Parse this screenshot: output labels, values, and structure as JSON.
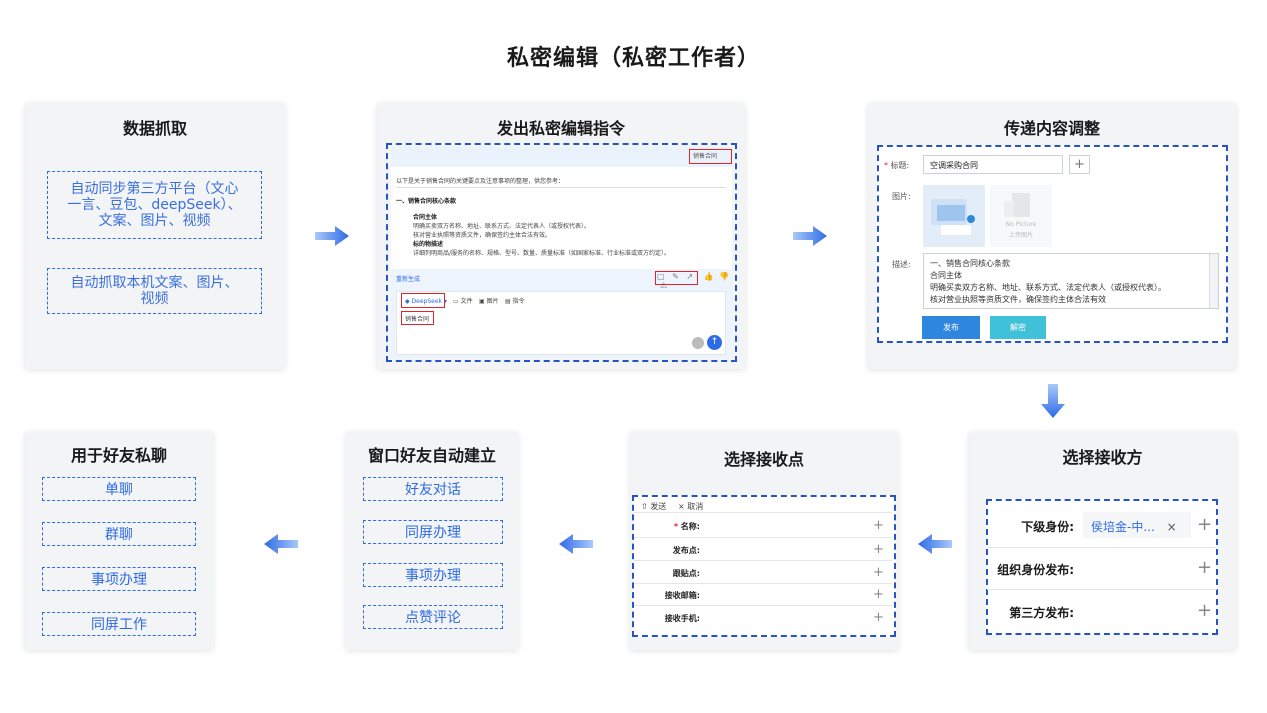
{
  "page_title": "私密编辑（私密工作者）",
  "card1": {
    "title": "数据抓取",
    "box1": "自动同步第三方平台（文心一言、豆包、deepSeek）、文案、图片、视频",
    "box1_lines": [
      "自动同步第三方平台（文心",
      "一言、豆包、deepSeek）、",
      "文案、图片、视频"
    ],
    "box2_lines": [
      "自动抓取本机文案、图片、",
      "视频"
    ]
  },
  "card2": {
    "title": "发出私密编辑指令",
    "tag_top": "销售合同",
    "intro": "以下是关于销售合同的关键要点及注意事项的整理，供您参考：",
    "section": "一、销售合同核心条款",
    "lines": [
      {
        "bold": true,
        "text": "合同主体"
      },
      {
        "bold": false,
        "text": "明确买卖双方名称、地址、联系方式、法定代表人（或授权代表）。"
      },
      {
        "bold": false,
        "text": "核对营业执照等资质文件，确保签约主体合法有效。"
      },
      {
        "bold": true,
        "text": "标的物描述"
      },
      {
        "bold": false,
        "text": "详细列明商品/服务的名称、规格、型号、数量、质量标准（如国家标准、行业标准或双方约定）。"
      }
    ],
    "regen": "重新生成",
    "toolbar": {
      "model": "DeepSeek",
      "file": "文件",
      "image": "图片",
      "cmd": "指令"
    },
    "input_value": "销售合同"
  },
  "card3": {
    "title": "传递内容调整",
    "title_label": "标题:",
    "title_value": "空调采购合同",
    "image_label": "图片:",
    "no_picture": "No Picture",
    "upload_text": "上传图片",
    "desc_label": "描述:",
    "desc_lines": [
      "一、销售合同核心条款",
      "合同主体",
      "明确买卖双方名称、地址、联系方式、法定代表人（或授权代表）。",
      "核对营业执照等资质文件，确保签约主体合法有效"
    ],
    "publish_btn": "发布",
    "decrypt_btn": "解密"
  },
  "card4": {
    "title": "选择接收方",
    "rows": [
      {
        "label": "下级身份:",
        "value": "侯培金-中...",
        "close": "×"
      },
      {
        "label": "组织身份发布:",
        "value": ""
      },
      {
        "label": "第三方发布:",
        "value": ""
      }
    ]
  },
  "card5": {
    "title": "选择接收点",
    "send": "发送",
    "cancel": "取消",
    "rows": [
      "名称:",
      "发布点:",
      "跟贴点:",
      "接收邮箱:",
      "接收手机:"
    ]
  },
  "card6": {
    "title": "窗口好友自动建立",
    "items": [
      "好友对话",
      "同屏办理",
      "事项办理",
      "点赞评论"
    ]
  },
  "card7": {
    "title": "用于好友私聊",
    "items": [
      "单聊",
      "群聊",
      "事项办理",
      "同屏工作"
    ]
  },
  "colors": {
    "accent": "#2e6be6",
    "card_bg": "#f3f4f6",
    "red": "#e0242a",
    "button": "#2e86de",
    "button2": "#3fc1d9"
  }
}
